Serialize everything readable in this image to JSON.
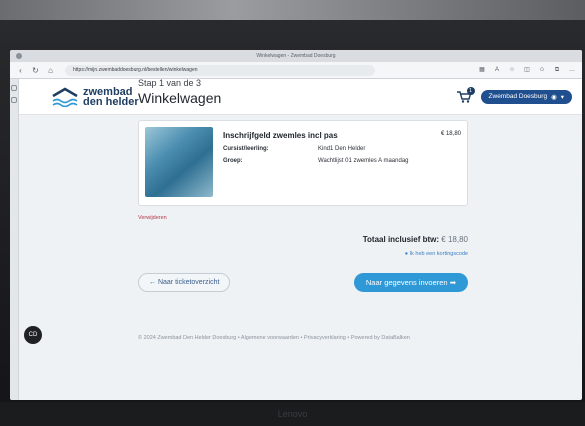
{
  "browser": {
    "tab_title": "Winkelwagen - Zwembad Doesburg",
    "url": "https://mijn.zwembaddoesburg.nl/bestellen/winkelwagen"
  },
  "header": {
    "logo_line1": "zwembad",
    "logo_line2": "den helder",
    "cart_count": "1",
    "account_label": "Zwembad Doesburg"
  },
  "main": {
    "step": "Stap 1 van de 3",
    "title": "Winkelwagen",
    "item": {
      "name": "Inschrijfgeld zwemles incl pas",
      "price": "€ 18,80",
      "rows": [
        {
          "key": "Cursist/leerling:",
          "value": "Kind1 Den Helder"
        },
        {
          "key": "Groep:",
          "value": "Wachtlijst 01 zwemles A maandag"
        }
      ]
    },
    "remove_label": "Verwijderen",
    "total_label": "Totaal inclusief btw:",
    "total_value": "€ 18,80",
    "coupon_label": "Ik heb een kortingscode",
    "back_button": "Naar ticketoverzicht",
    "next_button": "Naar gegevens invoeren"
  },
  "footer": {
    "text": "© 2024 Zwembad Den Helder Doesburg • Algemene voorwaarden • Privacyverklaring • Powered by DataBalken"
  },
  "chat_label": "CD",
  "brand": "Lenovo",
  "colors": {
    "primary": "#2f98d6",
    "brand_dark": "#1f3e63",
    "remove": "#b23a48"
  }
}
